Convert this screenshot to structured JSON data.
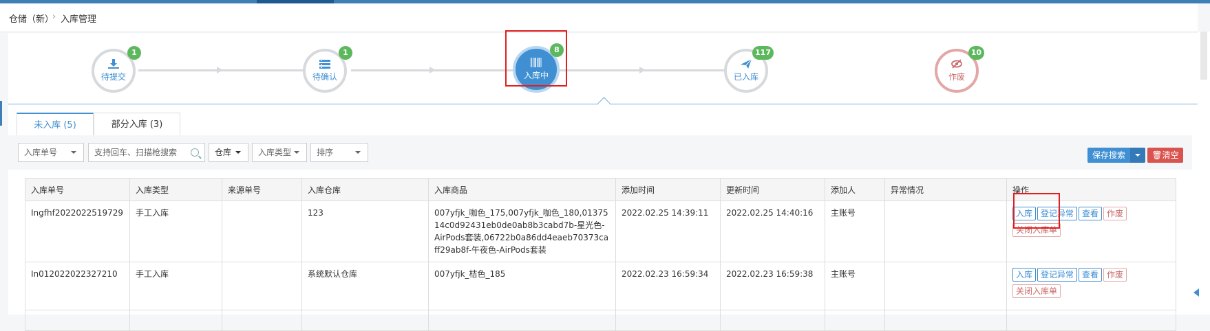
{
  "breadcrumb": {
    "root": "仓储（新）",
    "separator": "›",
    "current": "入库管理"
  },
  "steps": [
    {
      "label": "待提交",
      "count": "1",
      "icon": "download-icon",
      "state": "normal"
    },
    {
      "label": "待确认",
      "count": "1",
      "icon": "list-icon",
      "state": "normal"
    },
    {
      "label": "入库中",
      "count": "8",
      "icon": "barcode-icon",
      "state": "active"
    },
    {
      "label": "已入库",
      "count": "117",
      "icon": "plane-icon",
      "state": "normal"
    },
    {
      "label": "作废",
      "count": "10",
      "icon": "eye-slash-icon",
      "state": "void"
    }
  ],
  "tabs": [
    {
      "label": "未入库 (5)",
      "active": true
    },
    {
      "label": "部分入库 (3)",
      "active": false
    }
  ],
  "filters": {
    "order_no_select": "入库单号",
    "search_placeholder": "支持回车、扫描枪搜索",
    "warehouse_select": "仓库",
    "type_select": "入库类型",
    "sort_select": "排序",
    "save_search": "保存搜索",
    "clear": "清空"
  },
  "table": {
    "headers": [
      "入库单号",
      "入库类型",
      "来源单号",
      "入库仓库",
      "入库商品",
      "添加时间",
      "更新时间",
      "添加人",
      "异常情况",
      "操作"
    ],
    "rows": [
      {
        "order_no": "Ingfhf2022022519729",
        "type": "手工入库",
        "source_no": "",
        "warehouse": "123",
        "goods": "007yfjk_咖色_175,007yfjk_咖色_180,0137514c0d92431eb0de0ab8b3cabd7b-星光色-AirPods套装,06722b0a86dd4eaeb70373caff29ab8f-午夜色-AirPods套装",
        "added": "2022.02.25 14:39:11",
        "updated": "2022.02.25 14:40:16",
        "adder": "主账号",
        "exception": ""
      },
      {
        "order_no": "In012022022327210",
        "type": "手工入库",
        "source_no": "",
        "warehouse": "系统默认仓库",
        "goods": "007yfjk_桔色_185",
        "added": "2022.02.23 16:59:34",
        "updated": "2022.02.23 16:59:38",
        "adder": "主账号",
        "exception": ""
      }
    ],
    "actions": {
      "stock_in": "入库",
      "register_exception": "登记异常",
      "view": "查看",
      "void": "作废",
      "close": "关闭入库单"
    }
  },
  "colors": {
    "primary": "#3f8fd2",
    "success_badge": "#5cb85c",
    "danger": "#d9534f",
    "highlight": "#e02020"
  }
}
